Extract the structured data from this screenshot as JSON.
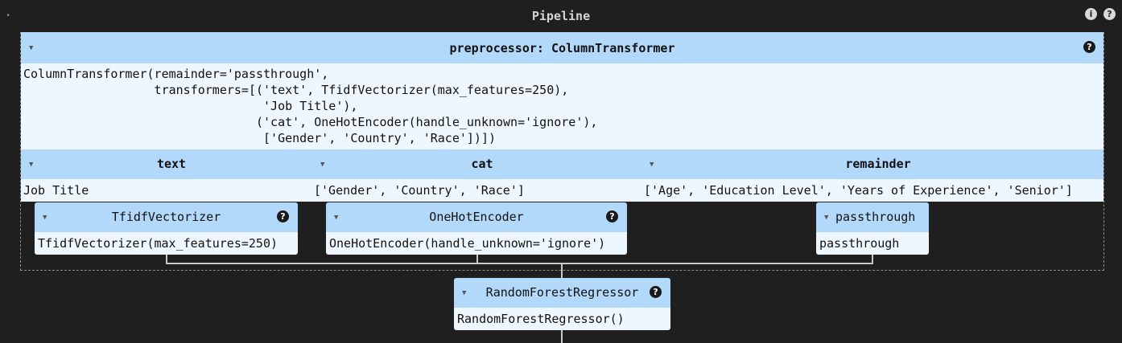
{
  "pipeline": {
    "title": "Pipeline",
    "info_icon": "info-icon",
    "help_icon": "help-icon"
  },
  "preprocessor": {
    "title": "preprocessor: ColumnTransformer",
    "repr": "ColumnTransformer(remainder='passthrough',\n                  transformers=[('text', TfidfVectorizer(max_features=250),\n                                 'Job Title'),\n                                ('cat', OneHotEncoder(handle_unknown='ignore'),\n                                 ['Gender', 'Country', 'Race'])])"
  },
  "columns": [
    {
      "name": "text",
      "value": "Job Title"
    },
    {
      "name": "cat",
      "value": "['Gender', 'Country', 'Race']"
    },
    {
      "name": "remainder",
      "value": "['Age', 'Education Level', 'Years of Experience', 'Senior']"
    }
  ],
  "transformers": [
    {
      "title": "TfidfVectorizer",
      "repr": "TfidfVectorizer(max_features=250)"
    },
    {
      "title": "OneHotEncoder",
      "repr": "OneHotEncoder(handle_unknown='ignore')"
    },
    {
      "title": "passthrough",
      "repr": "passthrough"
    }
  ],
  "regressor": {
    "title": "RandomForestRegressor",
    "repr": "RandomForestRegressor()"
  },
  "colors": {
    "header_bg": "#b3d9fa",
    "body_bg": "#eff7fe",
    "page_bg": "#1f1f1f",
    "connector": "#c8c8c8"
  }
}
